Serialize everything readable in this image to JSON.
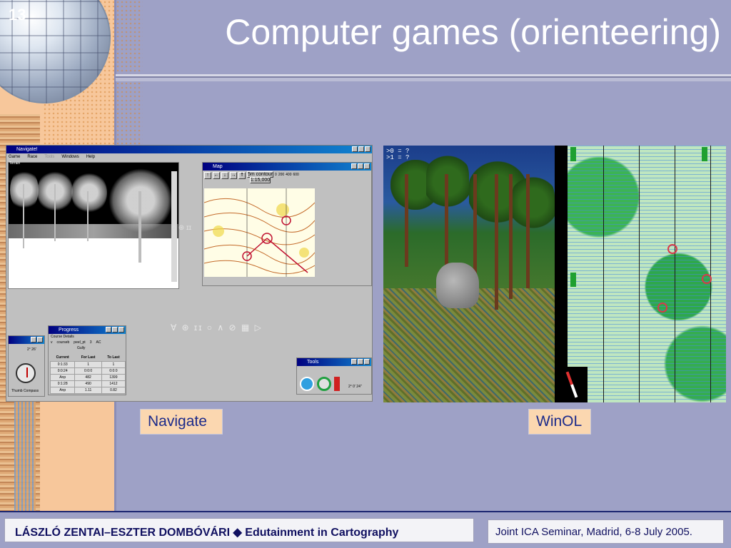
{
  "slide": {
    "number": "13",
    "title": "Computer games (orienteering)"
  },
  "navigate_screenshot": {
    "window_title": "Navigate!",
    "menu": [
      "Game",
      "Race",
      "Tools",
      "Windows",
      "Help"
    ],
    "terrain_label": "Terrain",
    "map_window_title": "Map",
    "map_contour_label": "5m contour",
    "map_scale_label": "1:15,000",
    "map_scale_ticks": [
      "0",
      "200",
      "400",
      "600"
    ],
    "compass_label": "Thumb Compass",
    "compass_bearing": "2° 26'",
    "progress_window_title": "Progress",
    "course_details_label": "Course Details",
    "course_row": [
      "v",
      "courseb",
      "peel_pt",
      "3",
      "AC"
    ],
    "course_name": "Gully",
    "table_headers": [
      "Current",
      "For Last",
      "To Last"
    ],
    "table_rows": [
      [
        "0:1:33",
        "1",
        "1"
      ],
      [
        "0:0:24",
        "0:0:0",
        "0:0:0"
      ],
      [
        "Anp",
        "482",
        "1399"
      ],
      [
        "0:1:28",
        "490",
        "1412"
      ],
      [
        "Anp",
        "1.11",
        "0.82"
      ]
    ],
    "tools_window_title": "Tools",
    "tools_coords": "2° 0' 24\""
  },
  "winol_screenshot": {
    "hud_lines": [
      ">0 = ?",
      ">1 = ?"
    ]
  },
  "captions": {
    "navigate": "Navigate",
    "winol": "WinOL"
  },
  "footer": {
    "authors": "LÁSZLÓ ZENTAI–ESZTER DOMBÓVÁRI",
    "separator": "◆",
    "topic": "Edutainment in Cartography",
    "event": "Joint ICA Seminar, Madrid, 6-8 July 2005."
  },
  "colors": {
    "background": "#9ea1c6",
    "left_strip": "#f7c79b",
    "caption_bg": "#fbd7b0",
    "caption_text": "#1b2a8a",
    "footer_text": "#101060"
  }
}
